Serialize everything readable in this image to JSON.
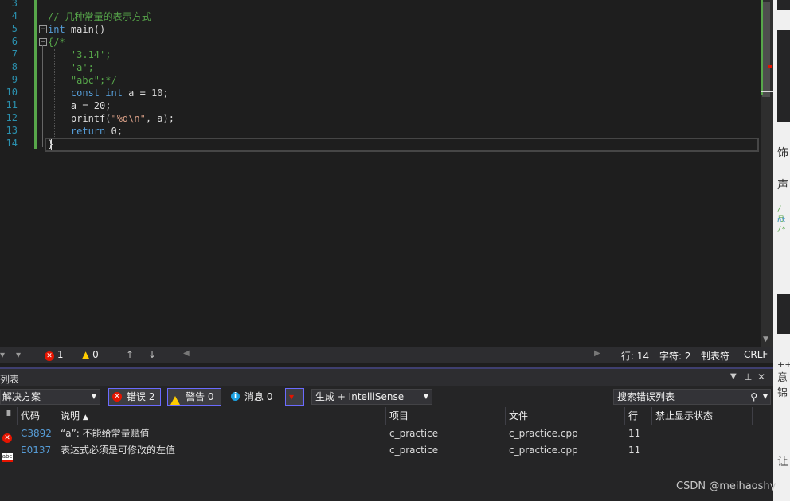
{
  "editor": {
    "line_numbers": [
      "3",
      "4",
      "5",
      "6",
      "7",
      "8",
      "9",
      "10",
      "11",
      "12",
      "13",
      "14"
    ],
    "lines": [
      {
        "segments": []
      },
      {
        "segments": [
          {
            "t": "// 几种常量的表示方式",
            "c": "cm"
          }
        ]
      },
      {
        "segments": [
          {
            "t": "int",
            "c": "kw"
          },
          {
            "t": " main()",
            "c": "pl"
          }
        ]
      },
      {
        "segments": [
          {
            "t": "{/*",
            "c": "cm"
          }
        ]
      },
      {
        "segments": [
          {
            "t": "    '3.14';",
            "c": "cm"
          }
        ]
      },
      {
        "segments": [
          {
            "t": "    'a';",
            "c": "cm"
          }
        ]
      },
      {
        "segments": [
          {
            "t": "    \"abc\";*/",
            "c": "cm"
          }
        ]
      },
      {
        "segments": [
          {
            "t": "    ",
            "c": "pl"
          },
          {
            "t": "const",
            "c": "kw"
          },
          {
            "t": " ",
            "c": "pl"
          },
          {
            "t": "int",
            "c": "kw"
          },
          {
            "t": " a = 10;",
            "c": "pl"
          }
        ]
      },
      {
        "segments": [
          {
            "t": "    a = 20;",
            "c": "pl"
          }
        ]
      },
      {
        "segments": [
          {
            "t": "    printf(",
            "c": "pl"
          },
          {
            "t": "\"%d\\n\"",
            "c": "str"
          },
          {
            "t": ", a);",
            "c": "pl"
          }
        ]
      },
      {
        "segments": [
          {
            "t": "    ",
            "c": "pl"
          },
          {
            "t": "return",
            "c": "kw"
          },
          {
            "t": " 0;",
            "c": "pl"
          }
        ]
      },
      {
        "segments": [
          {
            "t": "}",
            "c": "pl"
          }
        ]
      }
    ]
  },
  "editor_status": {
    "errors": "1",
    "warnings": "0",
    "line": "行: 14",
    "char": "字符: 2",
    "tabs": "制表符",
    "eol": "CRLF"
  },
  "panel": {
    "title": "列表",
    "scope": "解决方案",
    "errors_btn": "错误 2",
    "warnings_btn": "警告 0",
    "messages_btn": "消息 0",
    "build_filter": "生成 + IntelliSense",
    "search_placeholder": "搜索错误列表",
    "columns": [
      "代码",
      "说明",
      "项目",
      "文件",
      "行",
      "禁止显示状态"
    ],
    "rows": [
      {
        "icon": "error",
        "code": "C3892",
        "desc": "“a”: 不能给常量赋值",
        "project": "c_practice",
        "file": "c_practice.cpp",
        "line": "11",
        "suppress": ""
      },
      {
        "icon": "intellisense",
        "code": "E0137",
        "desc": "表达式必须是可修改的左值",
        "project": "c_practice",
        "file": "c_practice.cpp",
        "line": "11",
        "suppress": ""
      }
    ]
  },
  "right_strip": {
    "fragments": [
      "饰",
      "声",
      "/ 月",
      "nt",
      "/*",
      "++\\",
      "意锦",
      "让"
    ]
  },
  "watermark": "CSDN @meihaoshy",
  "colors": {
    "error": "#e51400",
    "warning": "#ffcc00",
    "info": "#1ba1e2",
    "changebar": "#57a64a",
    "keyword": "#569cd6",
    "comment": "#57a64a",
    "string": "#d69d85"
  }
}
